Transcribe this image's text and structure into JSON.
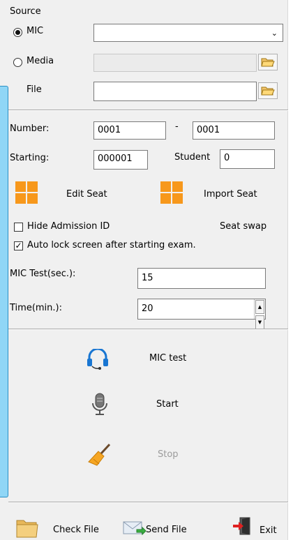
{
  "source": {
    "title": "Source",
    "mic_label": "MIC",
    "media_label": "Media",
    "file_label": "File",
    "mic_selected_value": "",
    "media_value": "",
    "file_value": ""
  },
  "settings": {
    "number_label": "Number:",
    "number_from": "0001",
    "number_dash": "-",
    "number_to": "0001",
    "starting_label": "Starting:",
    "starting_value": "000001",
    "student_label": "Student",
    "student_value": "0",
    "edit_seat_label": "Edit Seat",
    "import_seat_label": "Import Seat",
    "hide_admission_label": "Hide Admission ID",
    "seat_swap_label": "Seat swap",
    "auto_lock_label": "Auto lock screen after starting exam.",
    "auto_lock_checked": true,
    "hide_admission_checked": false,
    "mic_test_label": "MIC Test(sec.):",
    "mic_test_value": "15",
    "time_label": "Time(min.):",
    "time_value": "20"
  },
  "actions": {
    "mic_test_label": "MIC test",
    "start_label": "Start",
    "stop_label": "Stop"
  },
  "footer": {
    "check_file_label": "Check File",
    "send_file_label": "Send File",
    "exit_label": "Exit"
  },
  "colors": {
    "accent_orange": "#f7981c",
    "sidebar_blue": "#90d6f6",
    "icon_blue": "#1976d2"
  }
}
